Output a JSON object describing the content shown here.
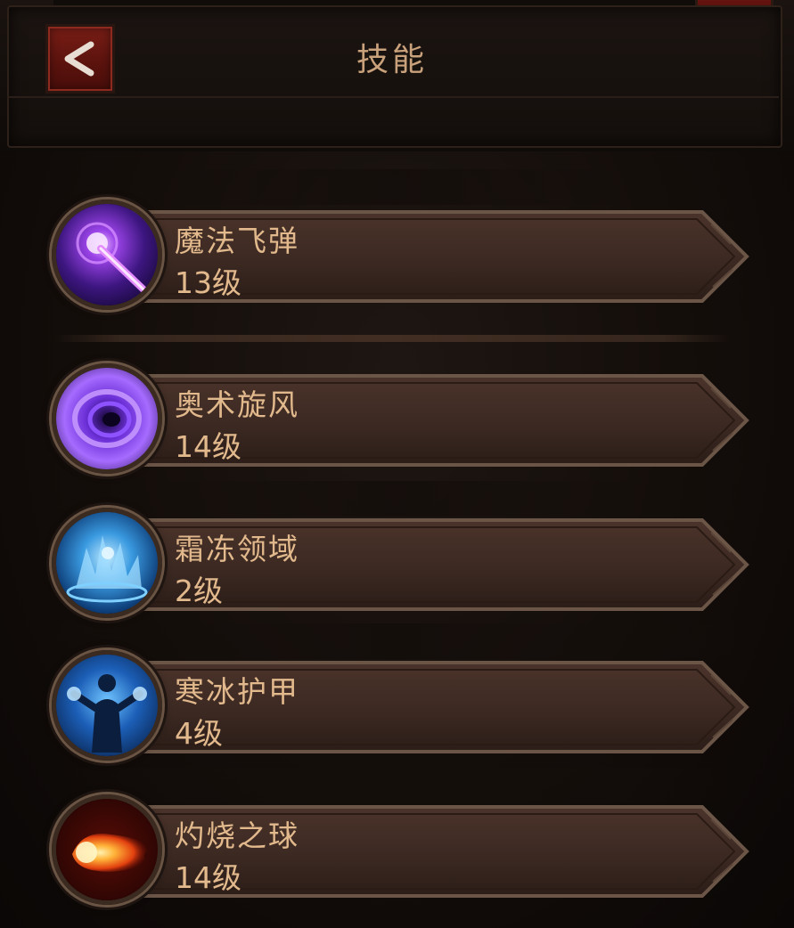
{
  "header": {
    "title": "技能",
    "back_icon": "chevron-left-icon"
  },
  "colors": {
    "text_gold": "#e2b98c",
    "bar_fill": "#3d2a23",
    "back_button_red": "#6a1810"
  },
  "skills": [
    {
      "name": "魔法飞弹",
      "level": "13级",
      "icon": "magic-missile-icon",
      "theme": "purple-bolt"
    },
    {
      "name": "奥术旋风",
      "level": "14级",
      "icon": "arcane-vortex-icon",
      "theme": "purple-vortex"
    },
    {
      "name": "霜冻领域",
      "level": "2级",
      "icon": "frost-domain-icon",
      "theme": "ice-blue"
    },
    {
      "name": "寒冰护甲",
      "level": "4级",
      "icon": "ice-armor-icon",
      "theme": "frost-figure"
    },
    {
      "name": "灼烧之球",
      "level": "14级",
      "icon": "fireball-icon",
      "theme": "fire-orb"
    }
  ]
}
